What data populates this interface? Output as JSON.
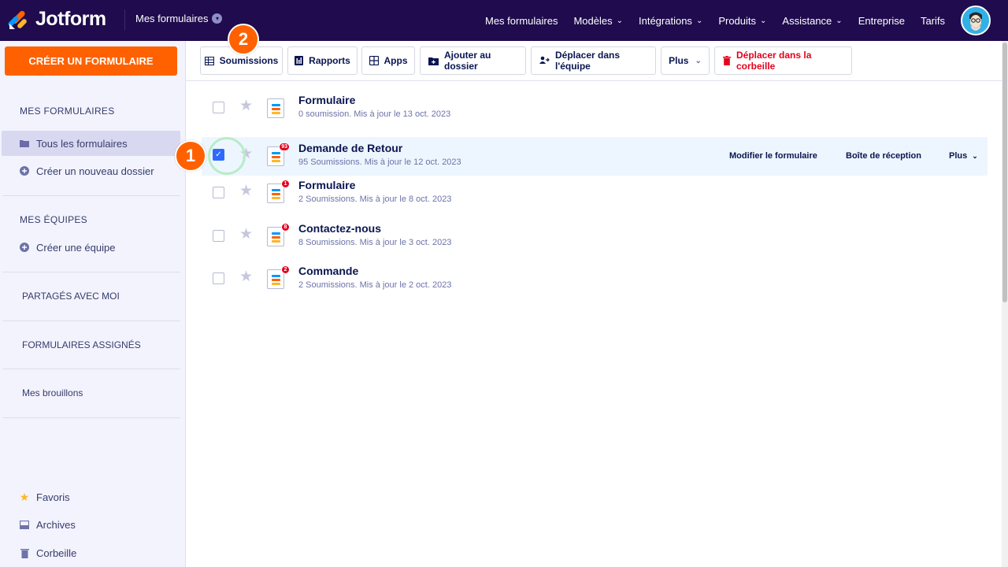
{
  "header": {
    "brand": "Jotform",
    "my_forms_dropdown": "Mes formulaires",
    "nav": [
      {
        "label": "Mes formulaires",
        "has_chevron": false
      },
      {
        "label": "Modèles",
        "has_chevron": true
      },
      {
        "label": "Intégrations",
        "has_chevron": true
      },
      {
        "label": "Produits",
        "has_chevron": true
      },
      {
        "label": "Assistance",
        "has_chevron": true
      },
      {
        "label": "Entreprise",
        "has_chevron": false
      },
      {
        "label": "Tarifs",
        "has_chevron": false
      }
    ]
  },
  "sidebar": {
    "create_button": "CRÉER UN FORMULAIRE",
    "my_forms_heading": "MES FORMULAIRES",
    "all_forms": "Tous les formulaires",
    "new_folder": "Créer un nouveau dossier",
    "teams_heading": "MES ÉQUIPES",
    "create_team": "Créer une équipe",
    "shared": "PARTAGÉS AVEC MOI",
    "assigned": "FORMULAIRES ASSIGNÉS",
    "drafts": "Mes brouillons",
    "favorites": "Favoris",
    "archives": "Archives",
    "trash": "Corbeille"
  },
  "toolbar": {
    "submissions": "Soumissions",
    "reports": "Rapports",
    "apps": "Apps",
    "add_to_folder": "Ajouter au dossier",
    "move_to_team": "Déplacer dans l'équipe",
    "more": "Plus",
    "move_to_trash": "Déplacer dans la corbeille"
  },
  "forms": [
    {
      "title": "Formulaire",
      "subtitle": "0 soumission. Mis à jour le 13 oct. 2023",
      "badge": "",
      "checked": false
    },
    {
      "title": "Demande de Retour",
      "subtitle": "95 Soumissions. Mis à jour le 12 oct. 2023",
      "badge": "93",
      "checked": true
    },
    {
      "title": "Formulaire",
      "subtitle": "2 Soumissions. Mis à jour le 8 oct. 2023",
      "badge": "1",
      "checked": false
    },
    {
      "title": "Contactez-nous",
      "subtitle": "8 Soumissions. Mis à jour le 3 oct. 2023",
      "badge": "8",
      "checked": false
    },
    {
      "title": "Commande",
      "subtitle": "2 Soumissions. Mis à jour le 2 oct. 2023",
      "badge": "2",
      "checked": false
    }
  ],
  "row_actions": {
    "edit": "Modifier le formulaire",
    "inbox": "Boîte de réception",
    "more": "Plus"
  },
  "markers": {
    "step1": "1",
    "step2": "2"
  },
  "colors": {
    "header_bg": "#1f0b4d",
    "create_button": "#ff6100",
    "marker": "#ff6100",
    "danger": "#e4001c",
    "selected_row": "#edf6fe",
    "checkbox_checked": "#2e69ff"
  }
}
